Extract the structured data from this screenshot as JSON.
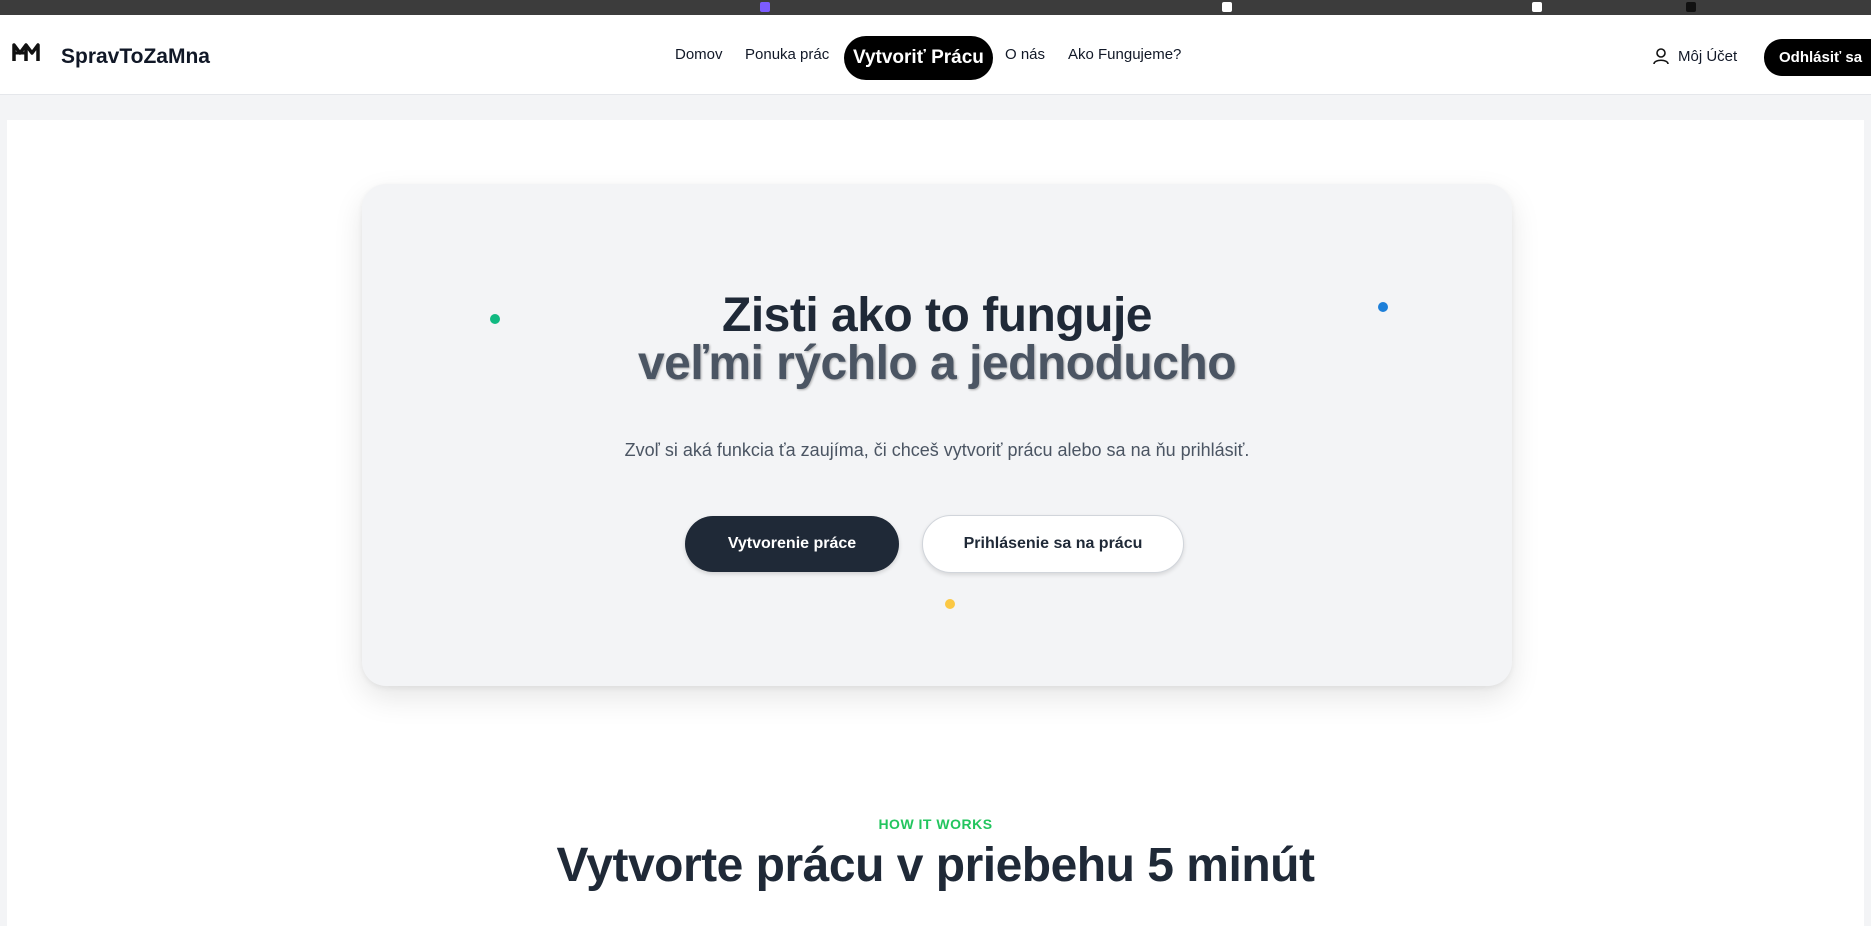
{
  "navbar": {
    "brand": "SpravToZaMna",
    "links": [
      "Domov",
      "Ponuka prác",
      "Vytvoriť Prácu",
      "O nás",
      "Ako Fungujeme?"
    ],
    "account_label": "Môj Účet",
    "logout_label": "Odhlásiť sa"
  },
  "hero": {
    "title_line1": "Zisti ako to funguje",
    "title_line2": "veľmi rýchlo a jednoducho",
    "subtitle": "Zvoľ si aká funkcia ťa zaujíma, či chceš vytvoriť prácu alebo sa na ňu prihlásiť.",
    "primary_button": "Vytvorenie práce",
    "secondary_button": "Prihlásenie sa na prácu"
  },
  "how_it_works": {
    "eyebrow": "HOW IT WORKS",
    "title": "Vytvorte prácu v priebehu 5 minút"
  },
  "colors": {
    "primary": "#1f2937",
    "accent_green": "#22c55e",
    "dot_teal": "#10b981",
    "dot_blue": "#1d7fd9",
    "dot_yellow": "#fbbf24"
  }
}
